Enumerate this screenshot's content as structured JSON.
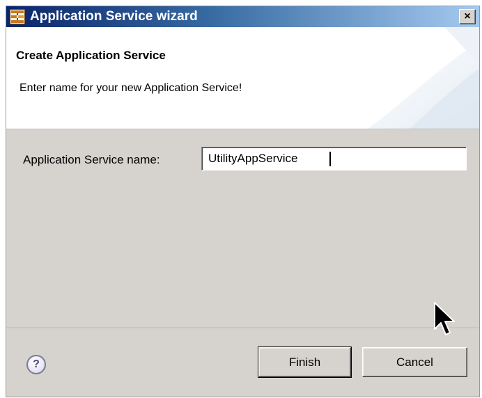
{
  "window": {
    "title": "Application Service wizard",
    "close_glyph": "×",
    "icon": "wizard-app-icon"
  },
  "banner": {
    "title": "Create Application Service",
    "message": "Enter name for your new Application Service!"
  },
  "form": {
    "name_label": "Application Service name:",
    "name_value": "UtilityAppService"
  },
  "footer": {
    "help_glyph": "?",
    "finish_label": "Finish",
    "cancel_label": "Cancel"
  },
  "colors": {
    "titlebar_start": "#0a246a",
    "titlebar_end": "#a6caf0",
    "dialog_bg": "#d6d3ce",
    "banner_bg": "#ffffff"
  }
}
